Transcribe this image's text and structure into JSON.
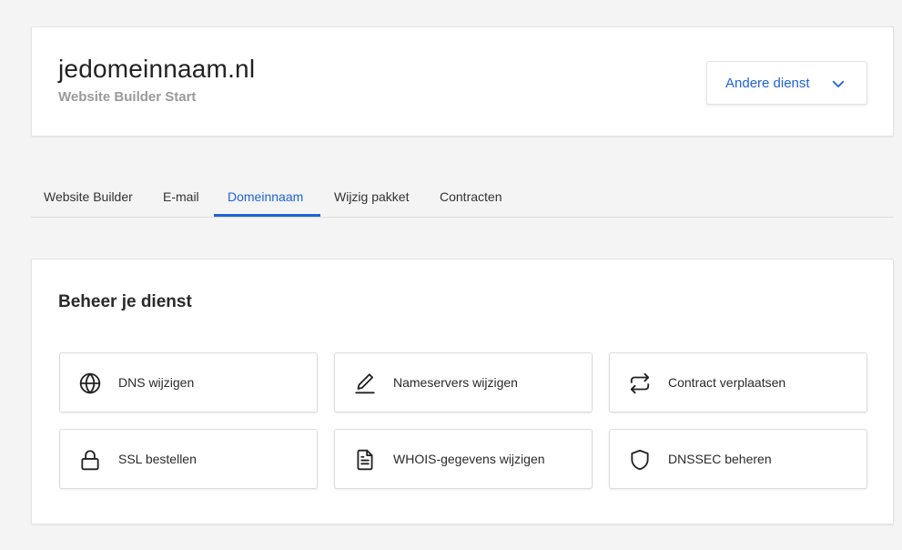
{
  "header": {
    "domain": "jedomeinnaam.nl",
    "package": "Website Builder Start",
    "other_service_label": "Andere dienst",
    "other_service_icon": "chevron-down-icon"
  },
  "tabs": [
    {
      "label": "Website Builder",
      "active": false
    },
    {
      "label": "E-mail",
      "active": false
    },
    {
      "label": "Domeinnaam",
      "active": true
    },
    {
      "label": "Wijzig pakket",
      "active": false
    },
    {
      "label": "Contracten",
      "active": false
    }
  ],
  "manage": {
    "title": "Beheer je dienst",
    "tiles": [
      {
        "label": "DNS wijzigen",
        "icon": "globe-icon"
      },
      {
        "label": "Nameservers wijzigen",
        "icon": "pencil-icon"
      },
      {
        "label": "Contract verplaatsen",
        "icon": "transfer-arrows-icon"
      },
      {
        "label": "SSL bestellen",
        "icon": "lock-icon"
      },
      {
        "label": "WHOIS-gegevens wijzigen",
        "icon": "document-icon"
      },
      {
        "label": "DNSSEC beheren",
        "icon": "shield-icon"
      }
    ]
  },
  "colors": {
    "accent": "#1d63d8",
    "background": "#f4f4f4",
    "muted_text": "#9a9a9a"
  }
}
